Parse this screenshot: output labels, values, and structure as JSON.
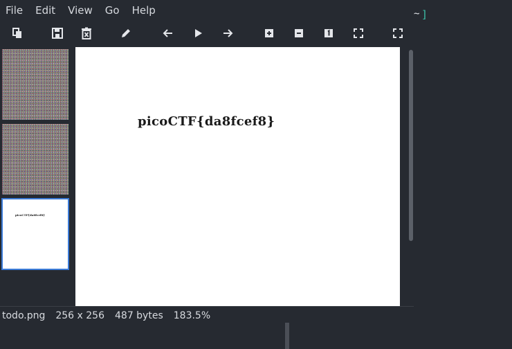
{
  "menu": [
    "File",
    "Edit",
    "View",
    "Go",
    "Help"
  ],
  "terminal": {
    "tilde": "~",
    "bracket": "]"
  },
  "toolbar": {
    "buttons": [
      "open-icon",
      "save-icon",
      "delete-icon",
      "edit-icon",
      "previous-icon",
      "play-icon",
      "next-icon",
      "zoom-in-icon",
      "zoom-out-icon",
      "actual-size-icon",
      "fit-window-icon",
      "fullscreen-icon"
    ]
  },
  "thumbnails": [
    {
      "kind": "noise"
    },
    {
      "kind": "noise"
    },
    {
      "kind": "image",
      "text": "picoCTF{da8fcef8}",
      "selected": true
    }
  ],
  "image": {
    "text": "picoCTF{da8fcef8}"
  },
  "status": {
    "filename": "todo.png",
    "dimensions": "256 x 256",
    "size": "487 bytes",
    "zoom": "183.5%"
  },
  "colors": {
    "background": "#262a31",
    "accent": "#3b7bd8",
    "terminal_bracket": "#3dc0a8"
  }
}
